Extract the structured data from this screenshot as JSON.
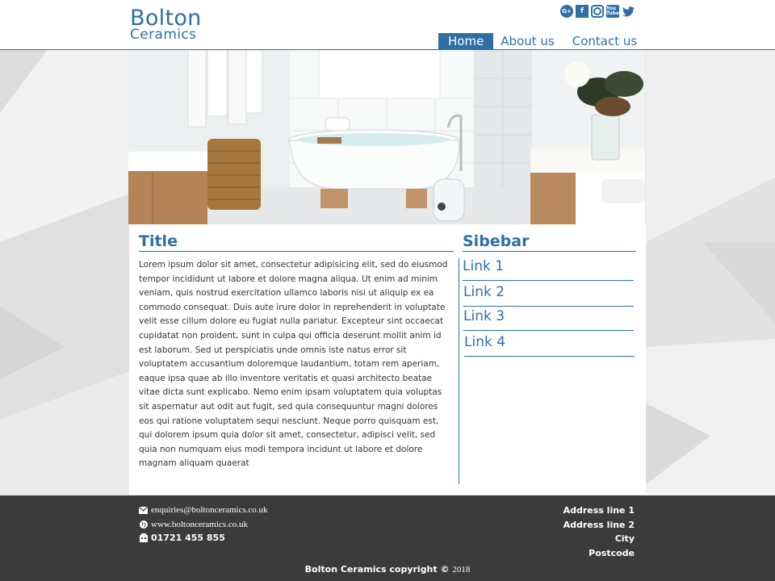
{
  "header": {
    "logo_line1": "Bolton",
    "logo_line2": "Ceramics",
    "social": [
      {
        "icon": "google-plus-icon",
        "glyph": "G+"
      },
      {
        "icon": "facebook-icon",
        "glyph": "f"
      },
      {
        "icon": "instagram-icon",
        "glyph": ""
      },
      {
        "icon": "youtube-icon",
        "glyph": "You Tube"
      },
      {
        "icon": "twitter-icon",
        "glyph": "🐦"
      }
    ],
    "nav": [
      {
        "label": "Home",
        "active": true
      },
      {
        "label": "About us",
        "active": false
      },
      {
        "label": "Contact us",
        "active": false
      }
    ]
  },
  "hero": {
    "alt": "bathroom-photo"
  },
  "main": {
    "title": "Title",
    "body": "Lorem ipsum dolor sit amet, consectetur adipisicing elit, sed do eiusmod tempor incididunt ut labore et dolore magna aliqua. Ut enim ad minim veniam, quis nostrud exercitation ullamco laboris nisi ut aliquip ex ea commodo consequat. Duis aute irure dolor in reprehenderit in voluptate velit esse cillum dolore eu fugiat nulla pariatur. Excepteur sint occaecat cupidatat non proident, sunt in culpa qui officia deserunt mollit anim id est laborum. Sed ut perspiciatis unde omnis iste natus error sit voluptatem accusantium doloremque laudantium, totam rem aperiam, eaque ipsa quae ab illo inventore veritatis et quasi architecto beatae vitae dicta sunt explicabo. Nemo enim ipsam voluptatem quia voluptas sit aspernatur aut odit aut fugit, sed quia consequuntur magni dolores eos qui ratione voluptatem sequi nesciunt. Neque porro quisquam est, qui dolorem ipsum quia dolor sit amet, consectetur, adipisci velit, sed quia non numquam eius modi tempora incidunt ut labore et dolore magnam aliquam quaerat"
  },
  "sidebar": {
    "title": "Sibebar",
    "links": [
      "Link 1",
      "Link 2",
      "Link 3",
      "Link 4"
    ]
  },
  "footer": {
    "email": "enquiries@boltonceramics.co.uk",
    "website": "www.boltonceramics.co.uk",
    "phone": "01721 455 855",
    "address": [
      "Address line 1",
      "Address line 2",
      "City",
      "Postcode"
    ],
    "copyright": "Bolton Ceramics copyright ©",
    "year": "2018"
  },
  "colors": {
    "accent": "#2e6fa6",
    "footer_bg": "#3b3b3b",
    "page_bg": "#e9e9e9"
  }
}
